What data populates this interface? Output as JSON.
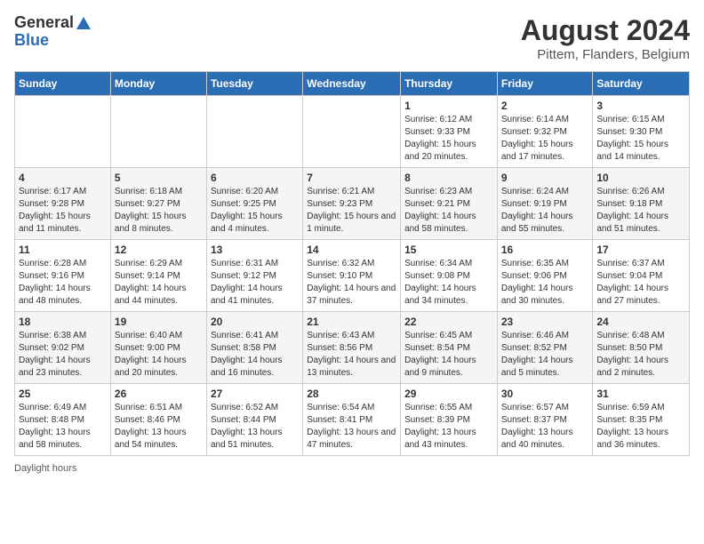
{
  "header": {
    "logo_general": "General",
    "logo_blue": "Blue",
    "month_year": "August 2024",
    "location": "Pittem, Flanders, Belgium"
  },
  "days_of_week": [
    "Sunday",
    "Monday",
    "Tuesday",
    "Wednesday",
    "Thursday",
    "Friday",
    "Saturday"
  ],
  "weeks": [
    [
      {
        "day": "",
        "info": ""
      },
      {
        "day": "",
        "info": ""
      },
      {
        "day": "",
        "info": ""
      },
      {
        "day": "",
        "info": ""
      },
      {
        "day": "1",
        "info": "Sunrise: 6:12 AM\nSunset: 9:33 PM\nDaylight: 15 hours and 20 minutes."
      },
      {
        "day": "2",
        "info": "Sunrise: 6:14 AM\nSunset: 9:32 PM\nDaylight: 15 hours and 17 minutes."
      },
      {
        "day": "3",
        "info": "Sunrise: 6:15 AM\nSunset: 9:30 PM\nDaylight: 15 hours and 14 minutes."
      }
    ],
    [
      {
        "day": "4",
        "info": "Sunrise: 6:17 AM\nSunset: 9:28 PM\nDaylight: 15 hours and 11 minutes."
      },
      {
        "day": "5",
        "info": "Sunrise: 6:18 AM\nSunset: 9:27 PM\nDaylight: 15 hours and 8 minutes."
      },
      {
        "day": "6",
        "info": "Sunrise: 6:20 AM\nSunset: 9:25 PM\nDaylight: 15 hours and 4 minutes."
      },
      {
        "day": "7",
        "info": "Sunrise: 6:21 AM\nSunset: 9:23 PM\nDaylight: 15 hours and 1 minute."
      },
      {
        "day": "8",
        "info": "Sunrise: 6:23 AM\nSunset: 9:21 PM\nDaylight: 14 hours and 58 minutes."
      },
      {
        "day": "9",
        "info": "Sunrise: 6:24 AM\nSunset: 9:19 PM\nDaylight: 14 hours and 55 minutes."
      },
      {
        "day": "10",
        "info": "Sunrise: 6:26 AM\nSunset: 9:18 PM\nDaylight: 14 hours and 51 minutes."
      }
    ],
    [
      {
        "day": "11",
        "info": "Sunrise: 6:28 AM\nSunset: 9:16 PM\nDaylight: 14 hours and 48 minutes."
      },
      {
        "day": "12",
        "info": "Sunrise: 6:29 AM\nSunset: 9:14 PM\nDaylight: 14 hours and 44 minutes."
      },
      {
        "day": "13",
        "info": "Sunrise: 6:31 AM\nSunset: 9:12 PM\nDaylight: 14 hours and 41 minutes."
      },
      {
        "day": "14",
        "info": "Sunrise: 6:32 AM\nSunset: 9:10 PM\nDaylight: 14 hours and 37 minutes."
      },
      {
        "day": "15",
        "info": "Sunrise: 6:34 AM\nSunset: 9:08 PM\nDaylight: 14 hours and 34 minutes."
      },
      {
        "day": "16",
        "info": "Sunrise: 6:35 AM\nSunset: 9:06 PM\nDaylight: 14 hours and 30 minutes."
      },
      {
        "day": "17",
        "info": "Sunrise: 6:37 AM\nSunset: 9:04 PM\nDaylight: 14 hours and 27 minutes."
      }
    ],
    [
      {
        "day": "18",
        "info": "Sunrise: 6:38 AM\nSunset: 9:02 PM\nDaylight: 14 hours and 23 minutes."
      },
      {
        "day": "19",
        "info": "Sunrise: 6:40 AM\nSunset: 9:00 PM\nDaylight: 14 hours and 20 minutes."
      },
      {
        "day": "20",
        "info": "Sunrise: 6:41 AM\nSunset: 8:58 PM\nDaylight: 14 hours and 16 minutes."
      },
      {
        "day": "21",
        "info": "Sunrise: 6:43 AM\nSunset: 8:56 PM\nDaylight: 14 hours and 13 minutes."
      },
      {
        "day": "22",
        "info": "Sunrise: 6:45 AM\nSunset: 8:54 PM\nDaylight: 14 hours and 9 minutes."
      },
      {
        "day": "23",
        "info": "Sunrise: 6:46 AM\nSunset: 8:52 PM\nDaylight: 14 hours and 5 minutes."
      },
      {
        "day": "24",
        "info": "Sunrise: 6:48 AM\nSunset: 8:50 PM\nDaylight: 14 hours and 2 minutes."
      }
    ],
    [
      {
        "day": "25",
        "info": "Sunrise: 6:49 AM\nSunset: 8:48 PM\nDaylight: 13 hours and 58 minutes."
      },
      {
        "day": "26",
        "info": "Sunrise: 6:51 AM\nSunset: 8:46 PM\nDaylight: 13 hours and 54 minutes."
      },
      {
        "day": "27",
        "info": "Sunrise: 6:52 AM\nSunset: 8:44 PM\nDaylight: 13 hours and 51 minutes."
      },
      {
        "day": "28",
        "info": "Sunrise: 6:54 AM\nSunset: 8:41 PM\nDaylight: 13 hours and 47 minutes."
      },
      {
        "day": "29",
        "info": "Sunrise: 6:55 AM\nSunset: 8:39 PM\nDaylight: 13 hours and 43 minutes."
      },
      {
        "day": "30",
        "info": "Sunrise: 6:57 AM\nSunset: 8:37 PM\nDaylight: 13 hours and 40 minutes."
      },
      {
        "day": "31",
        "info": "Sunrise: 6:59 AM\nSunset: 8:35 PM\nDaylight: 13 hours and 36 minutes."
      }
    ]
  ],
  "legend": {
    "daylight_hours": "Daylight hours"
  }
}
